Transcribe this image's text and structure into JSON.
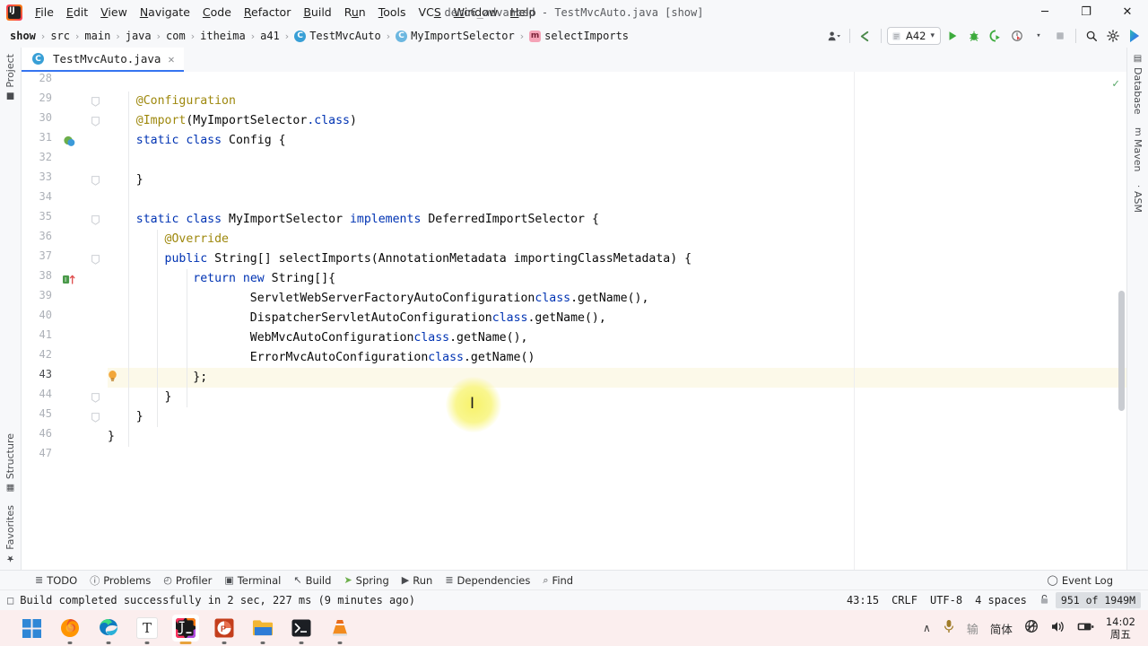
{
  "window": {
    "title": "demo6_advanced - TestMvcAuto.java [show]",
    "minimize": "─",
    "maximize": "❐",
    "close": "✕"
  },
  "menu": {
    "items": [
      {
        "label": "File"
      },
      {
        "label": "Edit"
      },
      {
        "label": "View"
      },
      {
        "label": "Navigate"
      },
      {
        "label": "Code"
      },
      {
        "label": "Refactor"
      },
      {
        "label": "Build"
      },
      {
        "label": "Run"
      },
      {
        "label": "Tools"
      },
      {
        "label": "VCS"
      },
      {
        "label": "Window"
      },
      {
        "label": "Help"
      }
    ]
  },
  "breadcrumb": {
    "items": [
      {
        "label": "show",
        "icon": "",
        "bold": true
      },
      {
        "label": "src",
        "icon": ""
      },
      {
        "label": "main",
        "icon": ""
      },
      {
        "label": "java",
        "icon": ""
      },
      {
        "label": "com",
        "icon": ""
      },
      {
        "label": "itheima",
        "icon": ""
      },
      {
        "label": "a41",
        "icon": ""
      },
      {
        "label": "TestMvcAuto",
        "icon": "class-icon",
        "glyph": "C"
      },
      {
        "label": "MyImportSelector",
        "icon": "class-icon",
        "glyph": "C"
      },
      {
        "label": "selectImports",
        "icon": "method-icon",
        "glyph": "m"
      }
    ],
    "separator": "›"
  },
  "toolbar": {
    "user_label": "user-settings-icon",
    "back_label": "back-arrow-icon",
    "run_config": "A42",
    "run_config_caret": "▾",
    "run_label": "▶",
    "debug_label": "debug-icon",
    "run_coverage_label": "run-with-coverage-icon",
    "profiler_label": "profiler-icon",
    "profiler_caret": "▾",
    "stop_label": "■",
    "search_label": "⌕",
    "settings_label": "⚙",
    "assistant_label": "ai-assistant-icon"
  },
  "left_stripe": {
    "items": [
      {
        "label": "Project",
        "icon": "■"
      },
      {
        "label": "Structure",
        "icon": "▦"
      },
      {
        "label": "Favorites",
        "icon": "★"
      }
    ]
  },
  "right_stripe": {
    "items": [
      {
        "label": "Database",
        "icon": "▤"
      },
      {
        "label": "Maven",
        "icon": "m"
      },
      {
        "label": "ASM",
        "icon": "·"
      }
    ]
  },
  "editor": {
    "tab": {
      "filename": "TestMvcAuto.java",
      "close": "✕",
      "icon_glyph": "C"
    },
    "inspection_ok": "✓",
    "caret_position": "43:15",
    "lines": [
      {
        "n": 28,
        "text": ""
      },
      {
        "n": 29,
        "text": "    @Configuration"
      },
      {
        "n": 30,
        "text": "    @Import(MyImportSelector.class)"
      },
      {
        "n": 31,
        "text": "    static class Config {"
      },
      {
        "n": 32,
        "text": ""
      },
      {
        "n": 33,
        "text": "    }"
      },
      {
        "n": 34,
        "text": ""
      },
      {
        "n": 35,
        "text": "    static class MyImportSelector implements DeferredImportSelector {"
      },
      {
        "n": 36,
        "text": "        @Override"
      },
      {
        "n": 37,
        "text": "        public String[] selectImports(AnnotationMetadata importingClassMetadata) {"
      },
      {
        "n": 38,
        "text": "            return new String[]{"
      },
      {
        "n": 39,
        "text": "                    ServletWebServerFactoryAutoConfiguration.class.getName(),"
      },
      {
        "n": 40,
        "text": "                    DispatcherServletAutoConfiguration.class.getName(),"
      },
      {
        "n": 41,
        "text": "                    WebMvcAutoConfiguration.class.getName(),"
      },
      {
        "n": 42,
        "text": "                    ErrorMvcAutoConfiguration.class.getName()"
      },
      {
        "n": 43,
        "text": "            };"
      },
      {
        "n": 44,
        "text": "        }"
      },
      {
        "n": 45,
        "text": "    }"
      },
      {
        "n": 46,
        "text": "}"
      },
      {
        "n": 47,
        "text": ""
      }
    ],
    "highlighted_line": 43,
    "gutter_icons": [
      {
        "line": 31,
        "name": "spring-bean-icon"
      },
      {
        "line": 37,
        "name": "implementing-method-icon"
      },
      {
        "line": 43,
        "name": "intention-bulb-icon"
      }
    ]
  },
  "bottom_tools": {
    "items": [
      {
        "label": "TODO",
        "icon": "≣"
      },
      {
        "label": "Problems",
        "icon": "ⓘ"
      },
      {
        "label": "Profiler",
        "icon": "◴"
      },
      {
        "label": "Terminal",
        "icon": "▣"
      },
      {
        "label": "Build",
        "icon": "↖"
      },
      {
        "label": "Spring",
        "icon": "➤"
      },
      {
        "label": "Run",
        "icon": "▶"
      },
      {
        "label": "Dependencies",
        "icon": "≣"
      },
      {
        "label": "Find",
        "icon": "⌕"
      }
    ],
    "event_log": {
      "label": "Event Log",
      "icon": "◯"
    }
  },
  "statusbar": {
    "build_icon": "□",
    "message": "Build completed successfully in 2 sec, 227 ms (9 minutes ago)",
    "caret": "43:15",
    "line_separator": "CRLF",
    "encoding": "UTF-8",
    "indent": "4 spaces",
    "lock_icon": "⚿",
    "memory": "951 of 1949M"
  },
  "taskbar": {
    "apps": [
      {
        "name": "windows-start-icon",
        "glyph": ""
      },
      {
        "name": "firefox-icon",
        "glyph": ""
      },
      {
        "name": "edge-icon",
        "glyph": ""
      },
      {
        "name": "typora-icon",
        "glyph": "T"
      },
      {
        "name": "intellij-idea-icon",
        "glyph": "IJ"
      },
      {
        "name": "powerpoint-icon",
        "glyph": "P"
      },
      {
        "name": "file-explorer-icon",
        "glyph": ""
      },
      {
        "name": "terminal-icon",
        "glyph": "❯_"
      },
      {
        "name": "vlc-icon",
        "glyph": ""
      }
    ],
    "tray": [
      {
        "name": "show-hidden-icons",
        "glyph": "∧"
      },
      {
        "name": "microphone-icon",
        "glyph": "Ἲ4"
      },
      {
        "name": "ime-mode-icon",
        "glyph": "输"
      },
      {
        "name": "ime-language-icon",
        "glyph": "简体"
      },
      {
        "name": "network-icon",
        "glyph": "⊕"
      },
      {
        "name": "volume-icon",
        "glyph": "ὐA"
      },
      {
        "name": "battery-icon",
        "glyph": "ὐB"
      }
    ],
    "clock_time": "14:02",
    "clock_day": "周五"
  },
  "colors": {
    "accent": "#3574f0",
    "keyword": "#0033b3",
    "annotation": "#9e880d",
    "highlight_line": "#fcf9e9",
    "panel_bg": "#f7f8fa",
    "editor_bg": "#ffffff",
    "taskbar_bg": "#fbeeee"
  }
}
